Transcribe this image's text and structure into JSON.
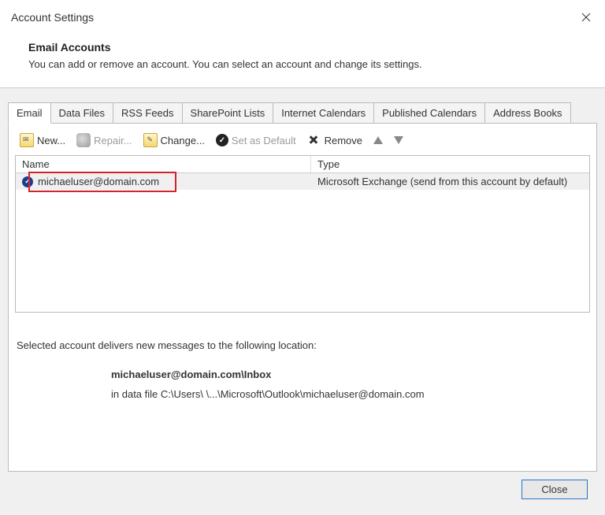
{
  "window": {
    "title": "Account Settings"
  },
  "header": {
    "title": "Email Accounts",
    "description": "You can add or remove an account. You can select an account and change its settings."
  },
  "tabs": [
    {
      "label": "Email",
      "active": true
    },
    {
      "label": "Data Files"
    },
    {
      "label": "RSS Feeds"
    },
    {
      "label": "SharePoint Lists"
    },
    {
      "label": "Internet Calendars"
    },
    {
      "label": "Published Calendars"
    },
    {
      "label": "Address Books"
    }
  ],
  "toolbar": {
    "new": "New...",
    "repair": "Repair...",
    "change": "Change...",
    "set_default": "Set as Default",
    "remove": "Remove"
  },
  "list": {
    "columns": {
      "name": "Name",
      "type": "Type"
    },
    "rows": [
      {
        "name": "michaeluser@domain.com",
        "type": "Microsoft Exchange (send from this account by default)",
        "highlighted": true,
        "default": true
      }
    ]
  },
  "delivery": {
    "intro": "Selected account delivers new messages to the following location:",
    "location_bold": "michaeluser@domain.com\\Inbox",
    "location_file": "in data file C:\\Users\\          \\...\\Microsoft\\Outlook\\michaeluser@domain.com"
  },
  "footer": {
    "close": "Close"
  }
}
